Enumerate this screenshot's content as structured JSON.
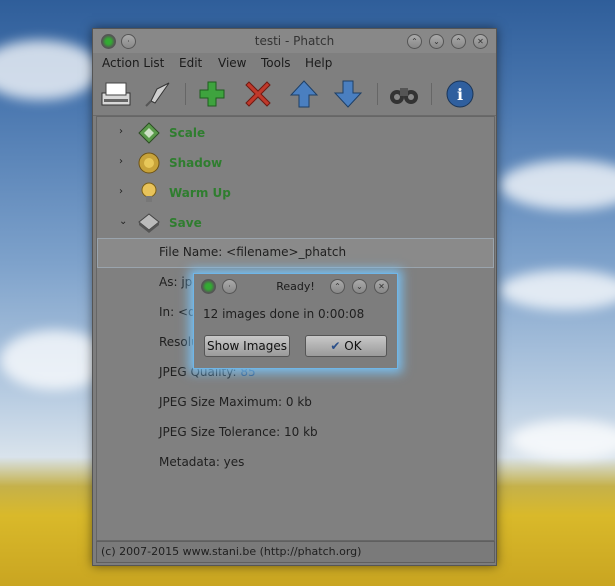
{
  "window": {
    "title": "testi - Phatch",
    "controls": [
      "up",
      "down",
      "maximize",
      "close"
    ]
  },
  "menu": [
    {
      "label": "Action List"
    },
    {
      "label": "Edit"
    },
    {
      "label": "View"
    },
    {
      "label": "Tools"
    },
    {
      "label": "Help"
    }
  ],
  "toolbar": [
    "process-icon",
    "rocket-icon",
    "add-icon",
    "delete-icon",
    "move-up-icon",
    "move-down-icon",
    "binoculars-icon",
    "info-icon"
  ],
  "actions": [
    {
      "label": "Scale",
      "icon": "scale-icon"
    },
    {
      "label": "Shadow",
      "icon": "shadow-icon"
    },
    {
      "label": "Warm Up",
      "icon": "bulb-icon"
    },
    {
      "label": "Save",
      "icon": "save-icon"
    }
  ],
  "properties": {
    "file_name": "File Name: <filename>_phatch",
    "as": "As: jpg",
    "in": "In: <desktop>",
    "resolution": "Resolution",
    "jpeg_quality_label": "JPEG Quality:",
    "jpeg_quality_value": "85",
    "jpeg_size_max": "JPEG Size Maximum: 0  kb",
    "jpeg_size_tol": "JPEG Size Tolerance: 10  kb",
    "metadata": "Metadata: yes"
  },
  "status": "(c) 2007-2015 www.stani.be (http://phatch.org)",
  "dialog": {
    "title": "Ready!",
    "message": "12 images done in 0:00:08",
    "show_images": "Show Images",
    "ok": "OK"
  }
}
